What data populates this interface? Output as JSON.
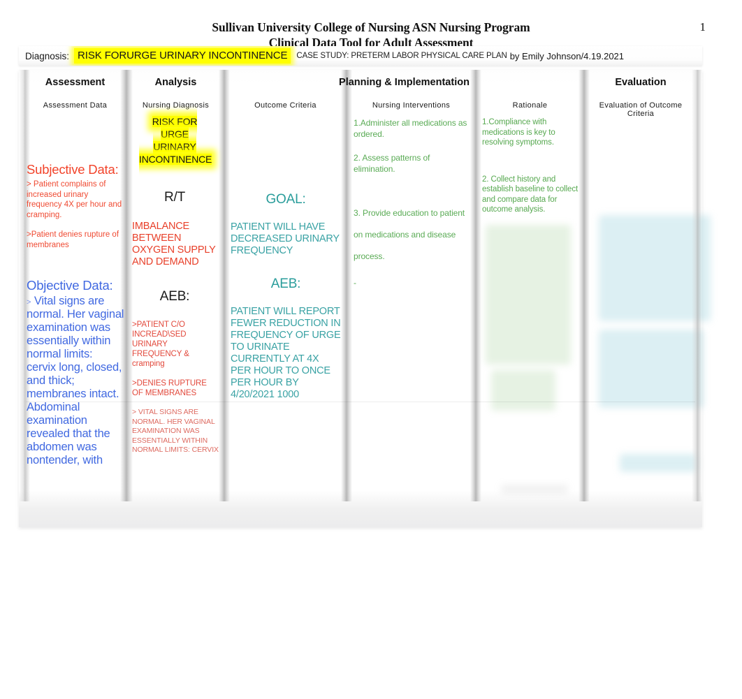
{
  "document": {
    "title_line1": "Sullivan University College of Nursing ASN Nursing Program",
    "title_line2": "Clinical Data Tool for Adult Assessment",
    "page_number": "1"
  },
  "diagnosis_bar": {
    "label": "Diagnosis:",
    "highlighted_diagnosis": "RISK FORURGE URINARY INCONTINENCE",
    "case_study": "CASE STUDY: PRETERM LABOR PHYSICAL CARE PLAN",
    "author": "by Emily Johnson/4.19.2021",
    "highlight_color": "#ffff00"
  },
  "table": {
    "group_headers": [
      {
        "label": "Assessment"
      },
      {
        "label": "Analysis"
      },
      {
        "label": "Planning  &  Implementation"
      },
      {
        "label": "Evaluation"
      }
    ],
    "column_headers": [
      {
        "label": "Assessment  Data"
      },
      {
        "label": "Nursing  Diagnosis"
      },
      {
        "label": "Outcome  Criteria"
      },
      {
        "label": "Nursing  Interventions"
      },
      {
        "label": "Rationale"
      },
      {
        "label": "Evaluation  of  Outcome  Criteria"
      }
    ],
    "assessment_data": {
      "subjective_heading": "Subjective Data:",
      "subjective_items": [
        ">  Patient complains of increased urinary frequency 4X per hour and cramping.",
        ">Patient denies rupture of membranes"
      ],
      "objective_heading": "Objective Data:",
      "objective_caret": ">",
      "objective_text": "Vital signs are normal. Her vaginal examination was essentially within normal limits: cervix long, closed, and thick; membranes intact. Abdominal examination revealed that the abdomen was nontender, with"
    },
    "nursing_diagnosis": {
      "highlighted": "RISK FOR URGE URINARY INCONTINENCE",
      "rt_label": "R/T",
      "rt_text": "IMBALANCE BETWEEN OXYGEN SUPPLY AND DEMAND",
      "aeb_label": "AEB:",
      "aeb_items": [
        ">PATIENT C/O INCREAD\\SED URINARY FREQUENCY & cramping",
        ">DENIES RUPTURE OF MEMBRANES"
      ],
      "aeb_small": "> VITAL SIGNS ARE NORMAL. HER VAGINAL EXAMINATION WAS ESSENTIALLY WITHIN NORMAL LIMITS: CERVIX"
    },
    "outcome_criteria": {
      "goal_label": "GOAL:",
      "goal_text": "PATIENT WILL HAVE DECREASED URINARY FREQUENCY",
      "aeb_label": "AEB:",
      "aeb_text": "PATIENT WILL REPORT FEWER REDUCTION IN FREQUENCY OF URGE TO URINATE CURRENTLY AT 4X PER HOUR TO ONCE PER HOUR BY 4/20/2021 1000"
    },
    "nursing_interventions": {
      "items": [
        "1.Administer all medications as ordered.",
        "2. Assess patterns of elimination.",
        "3. Provide education to patient on medications and disease process.",
        "-"
      ]
    },
    "rationale": {
      "items": [
        "1.Compliance with medications is key to resolving symptoms.",
        "2. Collect history and establish baseline to collect and compare data for outcome analysis."
      ]
    },
    "evaluation": {
      "items": []
    }
  }
}
